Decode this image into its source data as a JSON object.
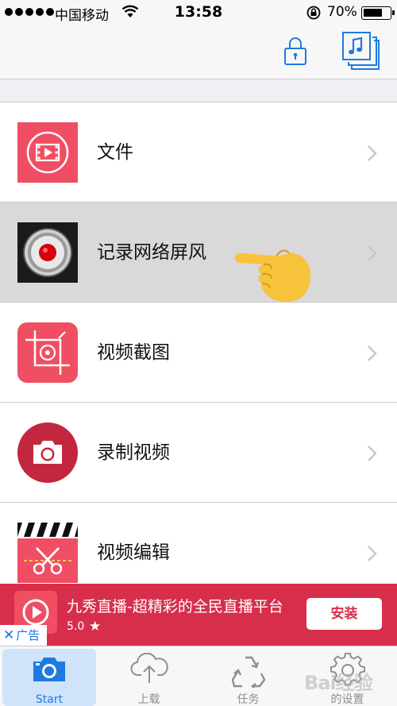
{
  "status_bar": {
    "carrier": "中国移动",
    "time": "13:58",
    "battery_percent": "70%",
    "battery_level": 0.7
  },
  "nav_bar": {
    "lock_icon": "lock-icon",
    "music_icon": "music-library-icon"
  },
  "list": {
    "items": [
      {
        "label": "文件",
        "icon": "video-file-icon",
        "highlighted": false
      },
      {
        "label": "记录网络屏风",
        "icon": "record-button-icon",
        "highlighted": true
      },
      {
        "label": "视频截图",
        "icon": "crop-icon",
        "highlighted": false
      },
      {
        "label": "录制视频",
        "icon": "camera-icon",
        "highlighted": false
      },
      {
        "label": "视频编辑",
        "icon": "clapperboard-scissors-icon",
        "highlighted": false
      }
    ]
  },
  "ad": {
    "title": "九秀直播-超精彩的全民直播平台",
    "rating": "5.0",
    "install_label": "安装",
    "ad_label": "广告",
    "close_symbol": "✕",
    "star_symbol": "★"
  },
  "tab_bar": {
    "tabs": [
      {
        "label": "Start",
        "icon": "camera-icon",
        "active": true
      },
      {
        "label": "上载",
        "icon": "cloud-upload-icon",
        "active": false
      },
      {
        "label": "任务",
        "icon": "recycle-icon",
        "active": false
      },
      {
        "label": "的设置",
        "icon": "gear-icon",
        "active": false
      }
    ]
  },
  "watermark": "Bai经验",
  "colors": {
    "accent_red": "#f04e63",
    "ad_red": "#d72f4b",
    "tab_active": "#1f7ae0",
    "highlight_row": "#d9d9d9"
  }
}
